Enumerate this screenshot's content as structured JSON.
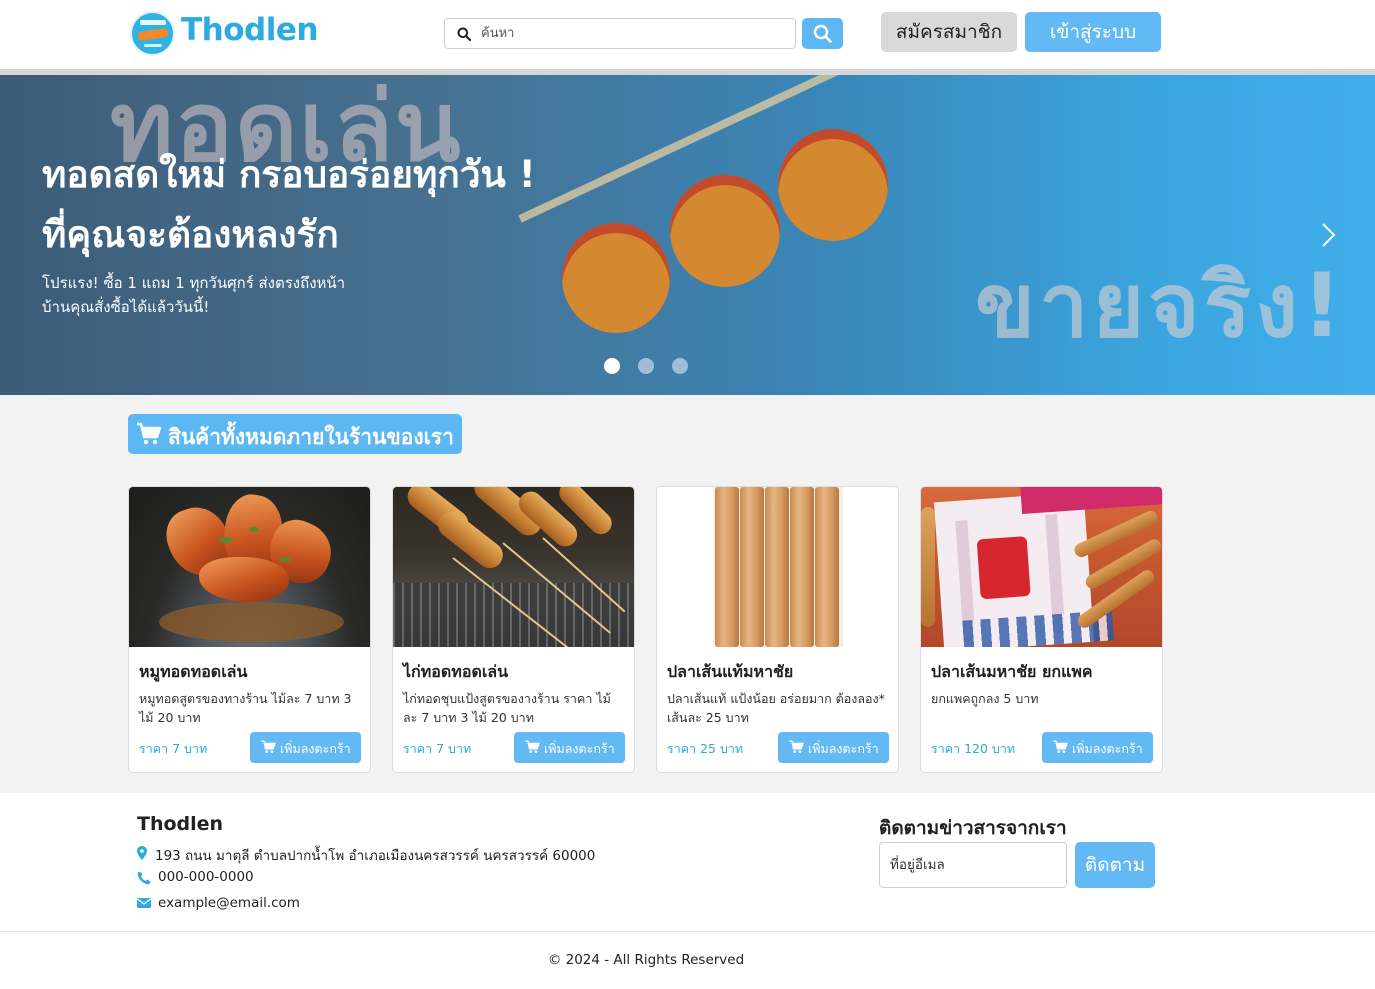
{
  "header": {
    "brand": "Thodlen",
    "search": {
      "placeholder": "ค้นหา"
    },
    "register_label": "สมัครสมาชิก",
    "login_label": "เข้าสู่ระบบ"
  },
  "hero": {
    "title_line1": "ทอดสดใหม่ กรอบอร่อยทุกวัน !",
    "title_line2": "ที่คุณจะต้องหลงรัก",
    "subtitle": "โปรแรง! ซื้อ 1 แถม 1 ทุกวันศุกร์ ส่งตรงถึงหน้าบ้านคุณสั่งซื้อได้แล้ววันนี้!",
    "bg_word_1": "ทอดเล่น",
    "bg_word_2": "ขายจริง!",
    "slides": 3,
    "active_slide": 1
  },
  "products_section": {
    "title": "สินค้าทั้งหมดภายในร้านของเรา"
  },
  "products": [
    {
      "name": "หมูทอดทอดเล่น",
      "desc": "หมูทอดสูตรของทางร้าน ไม้ละ 7 บาท 3 ไม้ 20 บาท",
      "price": "ราคา 7 บาท",
      "cta": "เพิ่มลงตะกร้า"
    },
    {
      "name": "ไก่ทอดทอดเล่น",
      "desc": "ไก่ทอดชุบแป้งสูตรของางร้าน ราคา ไม้ละ 7 บาท 3 ไม้ 20 บาท",
      "price": "ราคา 7 บาท",
      "cta": "เพิ่มลงตะกร้า"
    },
    {
      "name": "ปลาเส้นแท้มหาชัย",
      "desc": "ปลาเส้นแท้ แป้งน้อย อร่อยมาก ต้องลอง* เส้นละ 25 บาท",
      "price": "ราคา 25 บาท",
      "cta": "เพิ่มลงตะกร้า"
    },
    {
      "name": "ปลาเส้นมหาชัย ยกแพค",
      "desc": "ยกแพคถูกลง 5 บาท",
      "price": "ราคา 120 บาท",
      "cta": "เพิ่มลงตะกร้า"
    }
  ],
  "footer": {
    "brand": "Thodlen",
    "address": "193 ถนน มาตุลี ตำบลปากน้ำโพ อำเภอเมืองนครสวรรค์ นครสวรรค์ 60000",
    "phone": "000-000-0000",
    "email": "example@email.com",
    "follow_title": "ติดตามข่าวสารจากเรา",
    "email_placeholder": "ที่อยู่อีเมล",
    "follow_button": "ติดตาม",
    "copyright": "© 2024 - All Rights Reserved"
  },
  "colors": {
    "accent": "#63b9f3",
    "brand": "#2daadf",
    "price": "#2daadf"
  }
}
